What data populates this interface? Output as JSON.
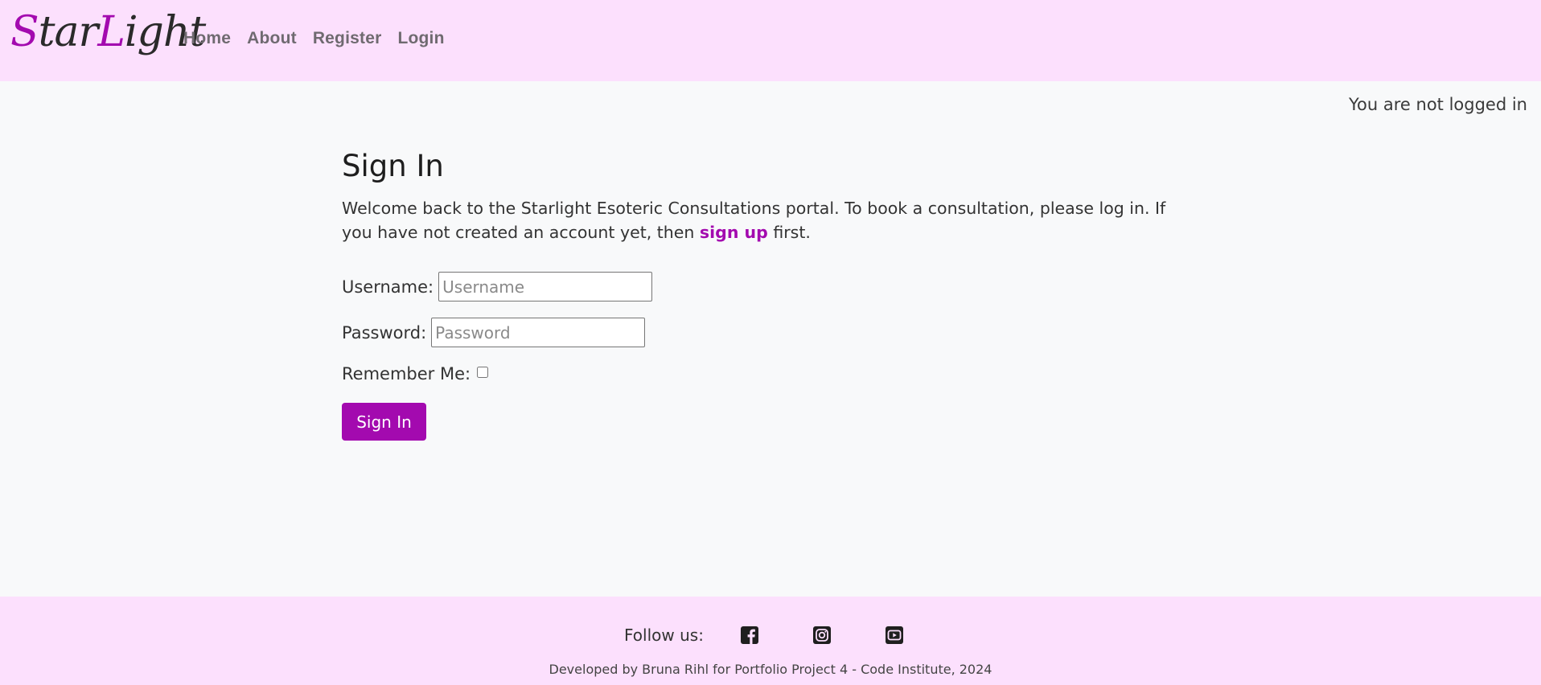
{
  "brand": {
    "letters": [
      {
        "t": "S",
        "accent": true
      },
      {
        "t": "tar",
        "accent": false
      },
      {
        "t": "L",
        "accent": true
      },
      {
        "t": "ight",
        "accent": false
      }
    ],
    "accent_color": "#a30aaf"
  },
  "nav": {
    "items": [
      {
        "label": "Home"
      },
      {
        "label": "About"
      },
      {
        "label": "Register"
      },
      {
        "label": "Login"
      }
    ]
  },
  "status": {
    "text": "You are not logged in"
  },
  "signin": {
    "title": "Sign In",
    "intro_before": "Welcome back to the Starlight Esoteric Consultations portal. To book a consultation, please log in. If you have not created an account yet, then ",
    "intro_link": "sign up",
    "intro_after": " first.",
    "username_label": "Username:",
    "username_placeholder": "Username",
    "username_value": "",
    "password_label": "Password:",
    "password_placeholder": "Password",
    "password_value": "",
    "remember_label": "Remember Me:",
    "remember_checked": false,
    "submit_label": "Sign In"
  },
  "footer": {
    "follow_label": "Follow us:",
    "social": [
      {
        "icon": "facebook-icon"
      },
      {
        "icon": "instagram-icon"
      },
      {
        "icon": "youtube-icon"
      }
    ],
    "credit": "Developed by Bruna Rihl for Portfolio Project 4 - Code Institute, 2024"
  },
  "colors": {
    "header_bg": "#fce0fd",
    "page_bg": "#f8f9fa",
    "accent": "#a30aaf"
  }
}
